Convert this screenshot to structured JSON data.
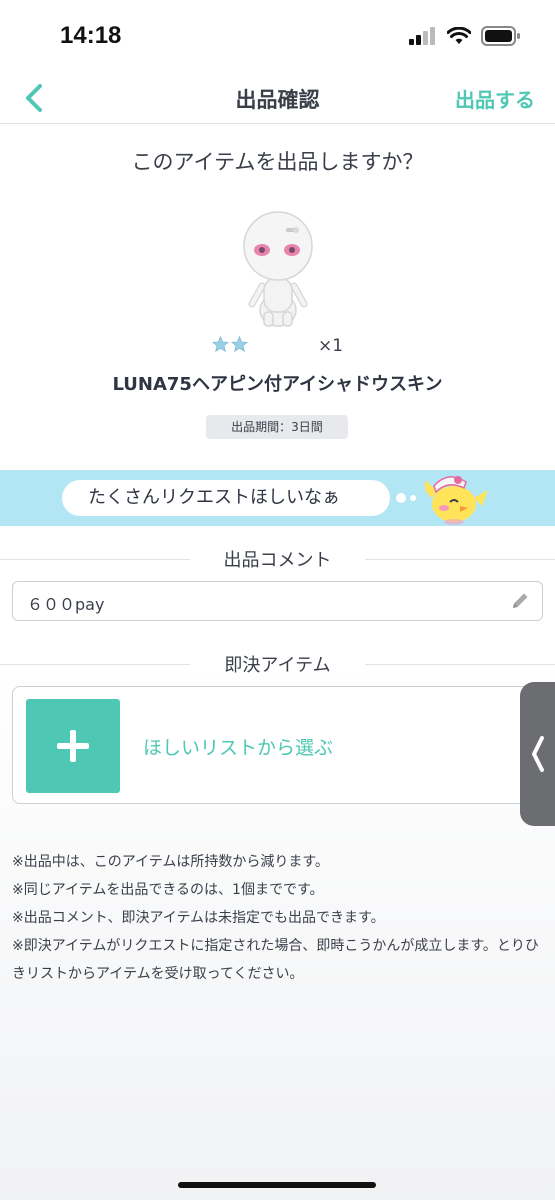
{
  "status_bar": {
    "time": "14:18"
  },
  "nav": {
    "title": "出品確認",
    "submit_label": "出品する"
  },
  "question": "このアイテムを出品しますか？",
  "item": {
    "rarity_stars": 2,
    "quantity": "×1",
    "name": "LUNA75ヘアピン付アイシャドウスキン",
    "period": "出品期間：3日間"
  },
  "banner": {
    "bubble_text": "たくさんリクエストほしいなぁ"
  },
  "comment_section": {
    "heading": "出品コメント",
    "value": "６００pay"
  },
  "instant_section": {
    "heading": "即決アイテム",
    "link_label": "ほしいリストから選ぶ"
  },
  "notes": [
    "※出品中は、このアイテムは所持数から減ります。",
    "※同じアイテムを出品できるのは、1個までです。",
    "※出品コメント、即決アイテムは未指定でも出品できます。",
    "※即決アイテムがリクエストに指定された場合、即時こうかんが成立します。とりひきリストからアイテムを受け取ってください。"
  ],
  "colors": {
    "accent": "#4ec8b4",
    "banner": "#b3e6f5",
    "text": "#3a3f4a"
  }
}
